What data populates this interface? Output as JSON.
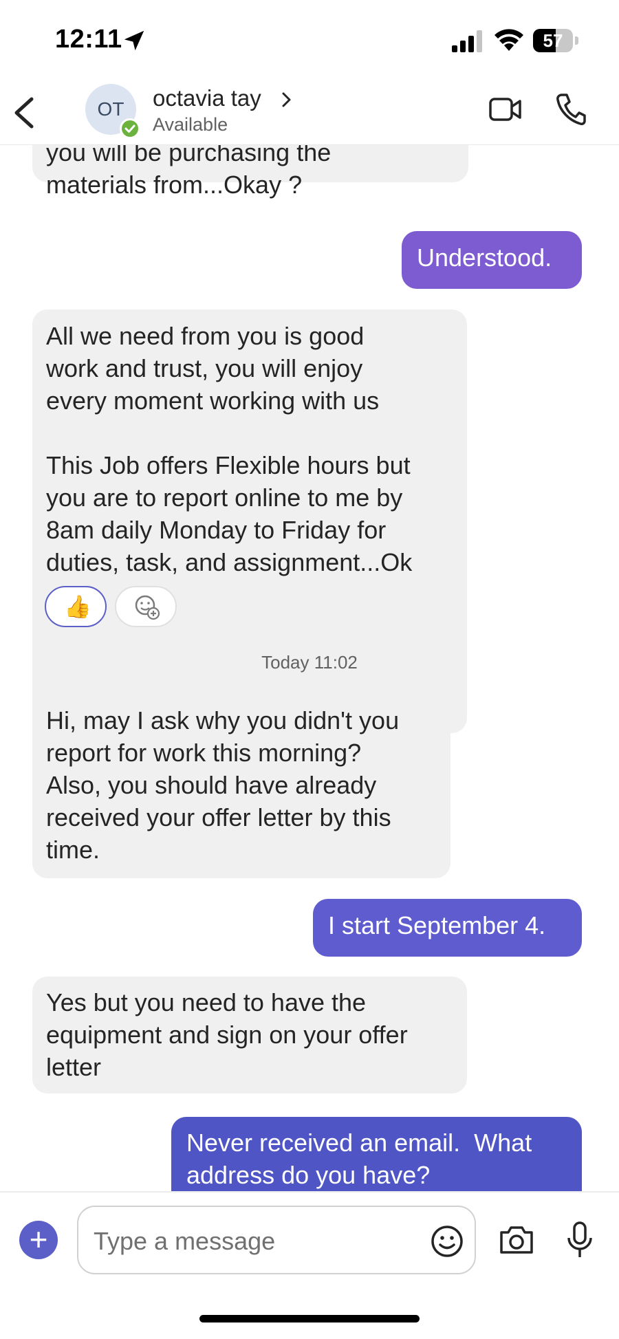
{
  "status_bar": {
    "time": "12:11",
    "battery": "57",
    "battery_level": 0.57
  },
  "header": {
    "back_label": "Back",
    "avatar_initials": "OT",
    "contact_name": "octavia tay",
    "presence": "Available"
  },
  "messages": [
    {
      "direction": "incoming",
      "text": "you will be purchasing the\nmaterials from...Okay ?"
    },
    {
      "direction": "outgoing",
      "text": "Understood.",
      "color": "#7d5bd0"
    },
    {
      "direction": "incoming",
      "text": "All we need from you is good\nwork and trust, you will enjoy\nevery moment working with us\n\nThis Job offers Flexible hours but\nyou are to report online to me by\n8am daily Monday to Friday for\nduties, task, and assignment...Ok",
      "reactions": [
        {
          "emoji": "👍",
          "icon": "thumbs-up-icon"
        },
        {
          "icon": "add-reaction-icon"
        }
      ]
    },
    {
      "direction": "incoming",
      "text": "Hi, may I ask why you didn't you\nreport for work this morning?\nAlso, you should have already\nreceived your offer letter by this\ntime."
    },
    {
      "direction": "outgoing",
      "text": "I start September 4.",
      "color": "#5f5ccf"
    },
    {
      "direction": "incoming",
      "text": "Yes but you need to have the\nequipment and sign on your offer\nletter"
    },
    {
      "direction": "outgoing",
      "text": "Never received an email.  What\naddress do you have?",
      "color": "#4f55c4"
    }
  ],
  "day_separator": "Today 11:02",
  "compose": {
    "placeholder": "Type a message"
  },
  "colors": {
    "accent": "#5b5fc7",
    "incoming_bubble": "#f0f0f0",
    "presence": "#6bb33e"
  }
}
